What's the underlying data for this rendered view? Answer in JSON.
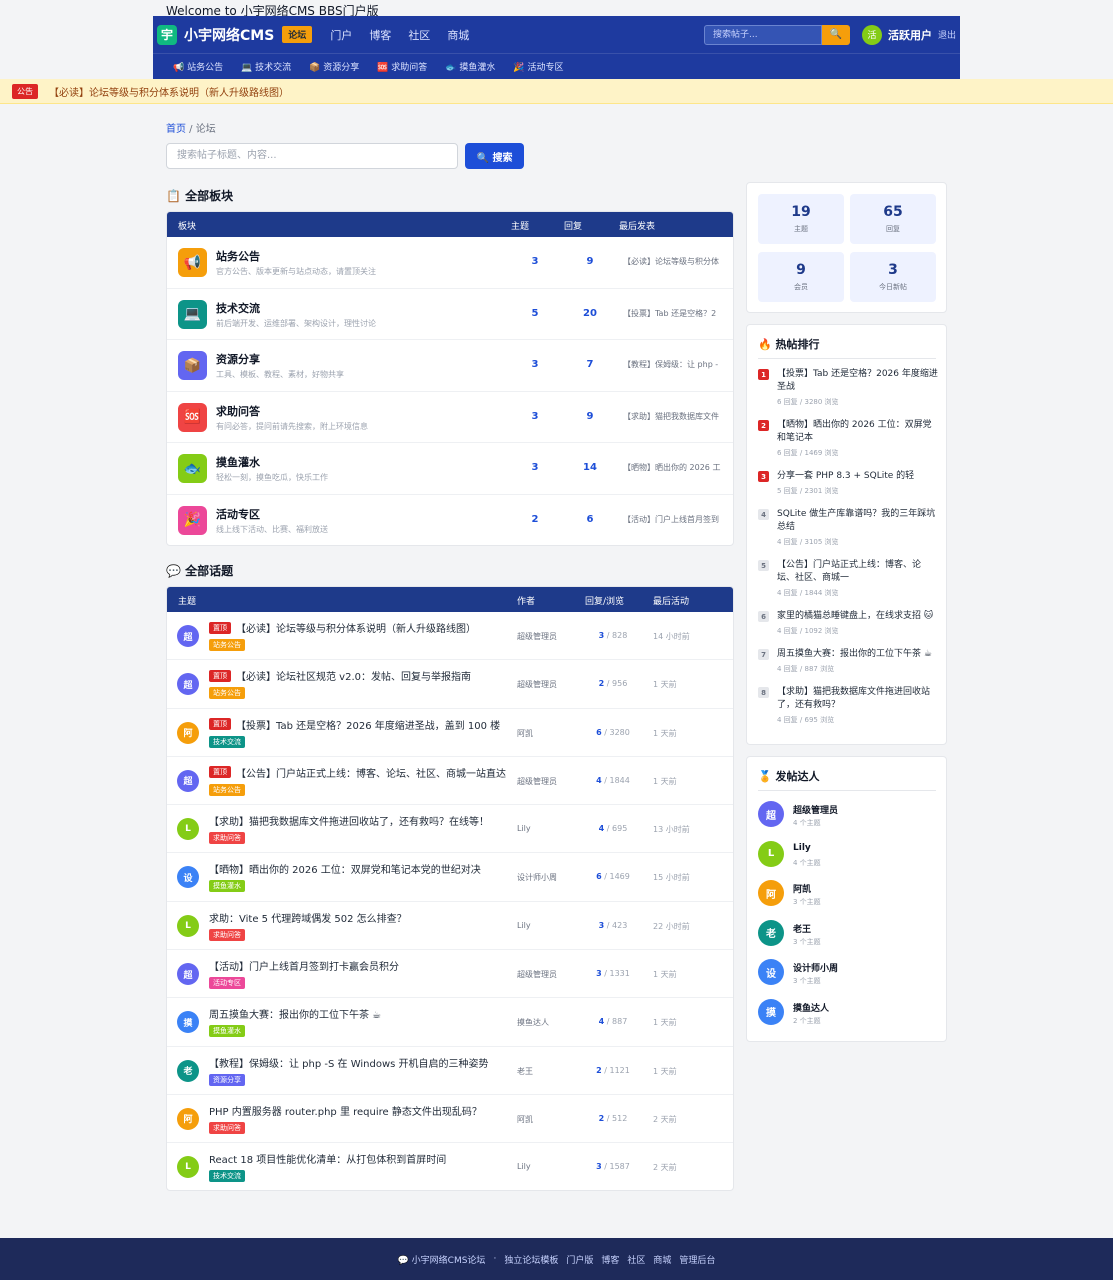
{
  "welcome": "Welcome to 小宇网络CMS BBS门户版",
  "header": {
    "logo_char": "宇",
    "site_name": "小宇网络CMS",
    "forum_tag": "论坛",
    "nav": [
      "门户",
      "博客",
      "社区",
      "商城"
    ],
    "search_placeholder": "搜索帖子...",
    "search_icon": "🔍",
    "user_avatar": "活",
    "user_name": "活跃用户",
    "logout": "退出",
    "sub_nav": [
      "📢 站务公告",
      "💻 技术交流",
      "📦 资源分享",
      "🆘 求助问答",
      "🐟 摸鱼灌水",
      "🎉 活动专区"
    ]
  },
  "notice": {
    "tag": "公告",
    "text": "【必读】论坛等级与积分体系说明（新人升级路线图）"
  },
  "breadcrumb": {
    "home": "首页",
    "sep": " / ",
    "current": "论坛"
  },
  "search": {
    "placeholder": "搜索帖子标题、内容...",
    "button": "🔍 搜索"
  },
  "boards": {
    "title": "📋 全部板块",
    "headers": [
      "板块",
      "主题",
      "回复",
      "最后发表"
    ],
    "items": [
      {
        "icon": "📢",
        "color": "#f59e0b",
        "name": "站务公告",
        "desc": "官方公告、版本更新与站点动态，请置顶关注",
        "topics": "3",
        "replies": "9",
        "last": "【必读】论坛等级与积分体"
      },
      {
        "icon": "💻",
        "color": "#0d9488",
        "name": "技术交流",
        "desc": "前后端开发、运维部署、架构设计，理性讨论",
        "topics": "5",
        "replies": "20",
        "last": "【投票】Tab 还是空格？2"
      },
      {
        "icon": "📦",
        "color": "#6366f1",
        "name": "资源分享",
        "desc": "工具、模板、教程、素材，好物共享",
        "topics": "3",
        "replies": "7",
        "last": "【教程】保姆级：让 php -"
      },
      {
        "icon": "🆘",
        "color": "#ef4444",
        "name": "求助问答",
        "desc": "有问必答，提问前请先搜索，附上环境信息",
        "topics": "3",
        "replies": "9",
        "last": "【求助】猫把我数据库文件"
      },
      {
        "icon": "🐟",
        "color": "#84cc16",
        "name": "摸鱼灌水",
        "desc": "轻松一刻，摸鱼吃瓜，快乐工作",
        "topics": "3",
        "replies": "14",
        "last": "【晒物】晒出你的 2026 工"
      },
      {
        "icon": "🎉",
        "color": "#ec4899",
        "name": "活动专区",
        "desc": "线上线下活动、比赛、福利放送",
        "topics": "2",
        "replies": "6",
        "last": "【活动】门户上线首月签到"
      }
    ]
  },
  "topics": {
    "title": "💬 全部话题",
    "headers": [
      "主题",
      "作者",
      "回复/浏览",
      "最后活动"
    ],
    "pin_label": "置顶",
    "items": [
      {
        "avatar": "超",
        "color": "#6366f1",
        "pinned": true,
        "title": "【必读】论坛等级与积分体系说明（新人升级路线图）",
        "board": "站务公告",
        "board_color": "#f59e0b",
        "author": "超级管理员",
        "replies": "3",
        "views": " / 828",
        "time": "14 小时前"
      },
      {
        "avatar": "超",
        "color": "#6366f1",
        "pinned": true,
        "title": "【必读】论坛社区规范 v2.0：发帖、回复与举报指南",
        "board": "站务公告",
        "board_color": "#f59e0b",
        "author": "超级管理员",
        "replies": "2",
        "views": " / 956",
        "time": "1 天前"
      },
      {
        "avatar": "阿",
        "color": "#f59e0b",
        "pinned": true,
        "title": "【投票】Tab 还是空格？2026 年度缩进圣战，盖到 100 楼",
        "board": "技术交流",
        "board_color": "#0d9488",
        "author": "阿凯",
        "replies": "6",
        "views": " / 3280",
        "time": "1 天前"
      },
      {
        "avatar": "超",
        "color": "#6366f1",
        "pinned": true,
        "title": "【公告】门户站正式上线：博客、论坛、社区、商城一站直达",
        "board": "站务公告",
        "board_color": "#f59e0b",
        "author": "超级管理员",
        "replies": "4",
        "views": " / 1844",
        "time": "1 天前"
      },
      {
        "avatar": "L",
        "color": "#84cc16",
        "pinned": false,
        "title": "【求助】猫把我数据库文件拖进回收站了，还有救吗？在线等！",
        "board": "求助问答",
        "board_color": "#ef4444",
        "author": "Lily",
        "replies": "4",
        "views": " / 695",
        "time": "13 小时前"
      },
      {
        "avatar": "设",
        "color": "#3b82f6",
        "pinned": false,
        "title": "【晒物】晒出你的 2026 工位：双屏党和笔记本党的世纪对决",
        "board": "摸鱼灌水",
        "board_color": "#84cc16",
        "author": "设计师小周",
        "replies": "6",
        "views": " / 1469",
        "time": "15 小时前"
      },
      {
        "avatar": "L",
        "color": "#84cc16",
        "pinned": false,
        "title": "求助：Vite 5 代理跨域偶发 502 怎么排查？",
        "board": "求助问答",
        "board_color": "#ef4444",
        "author": "Lily",
        "replies": "3",
        "views": " / 423",
        "time": "22 小时前"
      },
      {
        "avatar": "超",
        "color": "#6366f1",
        "pinned": false,
        "title": "【活动】门户上线首月签到打卡赢会员积分",
        "board": "活动专区",
        "board_color": "#ec4899",
        "author": "超级管理员",
        "replies": "3",
        "views": " / 1331",
        "time": "1 天前"
      },
      {
        "avatar": "摸",
        "color": "#3b82f6",
        "pinned": false,
        "title": "周五摸鱼大赛：报出你的工位下午茶 ☕",
        "board": "摸鱼灌水",
        "board_color": "#84cc16",
        "author": "摸鱼达人",
        "replies": "4",
        "views": " / 887",
        "time": "1 天前"
      },
      {
        "avatar": "老",
        "color": "#0d9488",
        "pinned": false,
        "title": "【教程】保姆级：让 php -S 在 Windows 开机自启的三种姿势",
        "board": "资源分享",
        "board_color": "#6366f1",
        "author": "老王",
        "replies": "2",
        "views": " / 1121",
        "time": "1 天前"
      },
      {
        "avatar": "阿",
        "color": "#f59e0b",
        "pinned": false,
        "title": "PHP 内置服务器 router.php 里 require 静态文件出现乱码？",
        "board": "求助问答",
        "board_color": "#ef4444",
        "author": "阿凯",
        "replies": "2",
        "views": " / 512",
        "time": "2 天前"
      },
      {
        "avatar": "L",
        "color": "#84cc16",
        "pinned": false,
        "title": "React 18 项目性能优化清单：从打包体积到首屏时间",
        "board": "技术交流",
        "board_color": "#0d9488",
        "author": "Lily",
        "replies": "3",
        "views": " / 1587",
        "time": "2 天前"
      }
    ]
  },
  "stats": [
    {
      "num": "19",
      "label": "主题"
    },
    {
      "num": "65",
      "label": "回复"
    },
    {
      "num": "9",
      "label": "会员"
    },
    {
      "num": "3",
      "label": "今日新帖"
    }
  ],
  "hot": {
    "title": "🔥 热帖排行",
    "items": [
      {
        "rank": "1",
        "title": "【投票】Tab 还是空格？2026 年度缩进圣战",
        "meta": "6 回复 / 3280 浏览"
      },
      {
        "rank": "2",
        "title": "【晒物】晒出你的 2026 工位：双屏党和笔记本",
        "meta": "6 回复 / 1469 浏览"
      },
      {
        "rank": "3",
        "title": "分享一套 PHP 8.3 + SQLite 的轻",
        "meta": "5 回复 / 2301 浏览"
      },
      {
        "rank": "4",
        "title": "SQLite 做生产库靠谱吗？我的三年踩坑总结",
        "meta": "4 回复 / 3105 浏览"
      },
      {
        "rank": "5",
        "title": "【公告】门户站正式上线：博客、论坛、社区、商城一",
        "meta": "4 回复 / 1844 浏览"
      },
      {
        "rank": "6",
        "title": "家里的橘猫总睡键盘上，在线求支招 🐱",
        "meta": "4 回复 / 1092 浏览"
      },
      {
        "rank": "7",
        "title": "周五摸鱼大赛：报出你的工位下午茶 ☕",
        "meta": "4 回复 / 887 浏览"
      },
      {
        "rank": "8",
        "title": "【求助】猫把我数据库文件拖进回收站了，还有救吗？",
        "meta": "4 回复 / 695 浏览"
      }
    ]
  },
  "masters": {
    "title": "🏅 发帖达人",
    "items": [
      {
        "avatar": "超",
        "color": "#6366f1",
        "name": "超级管理员",
        "count": "4 个主题"
      },
      {
        "avatar": "L",
        "color": "#84cc16",
        "name": "Lily",
        "count": "4 个主题"
      },
      {
        "avatar": "阿",
        "color": "#f59e0b",
        "name": "阿凯",
        "count": "3 个主题"
      },
      {
        "avatar": "老",
        "color": "#0d9488",
        "name": "老王",
        "count": "3 个主题"
      },
      {
        "avatar": "设",
        "color": "#3b82f6",
        "name": "设计师小周",
        "count": "3 个主题"
      },
      {
        "avatar": "摸",
        "color": "#3b82f6",
        "name": "摸鱼达人",
        "count": "2 个主题"
      }
    ]
  },
  "footer": [
    "💬 小宇网络CMS论坛",
    "·",
    "独立论坛模板",
    "门户版",
    "博客",
    "社区",
    "商城",
    "管理后台"
  ]
}
